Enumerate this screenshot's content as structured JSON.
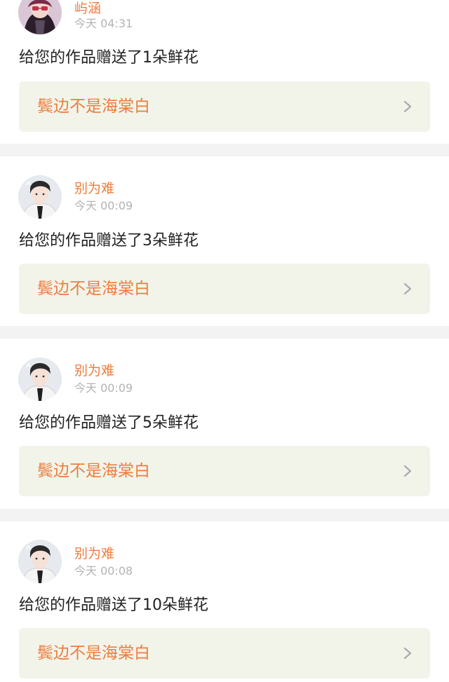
{
  "notifications": [
    {
      "user": "屿涵",
      "time": "今天 04:31",
      "message": "给您的作品赠送了1朵鲜花",
      "work_title": "鬓边不是海棠白",
      "avatar_icon": "avatar-girl-sunglasses-icon"
    },
    {
      "user": "别为难",
      "time": "今天 00:09",
      "message": "给您的作品赠送了3朵鲜花",
      "work_title": "鬓边不是海棠白",
      "avatar_icon": "avatar-boy-icon"
    },
    {
      "user": "别为难",
      "time": "今天 00:09",
      "message": "给您的作品赠送了5朵鲜花",
      "work_title": "鬓边不是海棠白",
      "avatar_icon": "avatar-boy-icon"
    },
    {
      "user": "别为难",
      "time": "今天 00:08",
      "message": "给您的作品赠送了10朵鲜花",
      "work_title": "鬓边不是海棠白",
      "avatar_icon": "avatar-boy-icon"
    }
  ],
  "colors": {
    "accent": "#ee7d3e",
    "link_background": "#f2f4ea",
    "separator": "#f3f3f3",
    "time_text": "#b3b3b3",
    "message_text": "#222222"
  }
}
